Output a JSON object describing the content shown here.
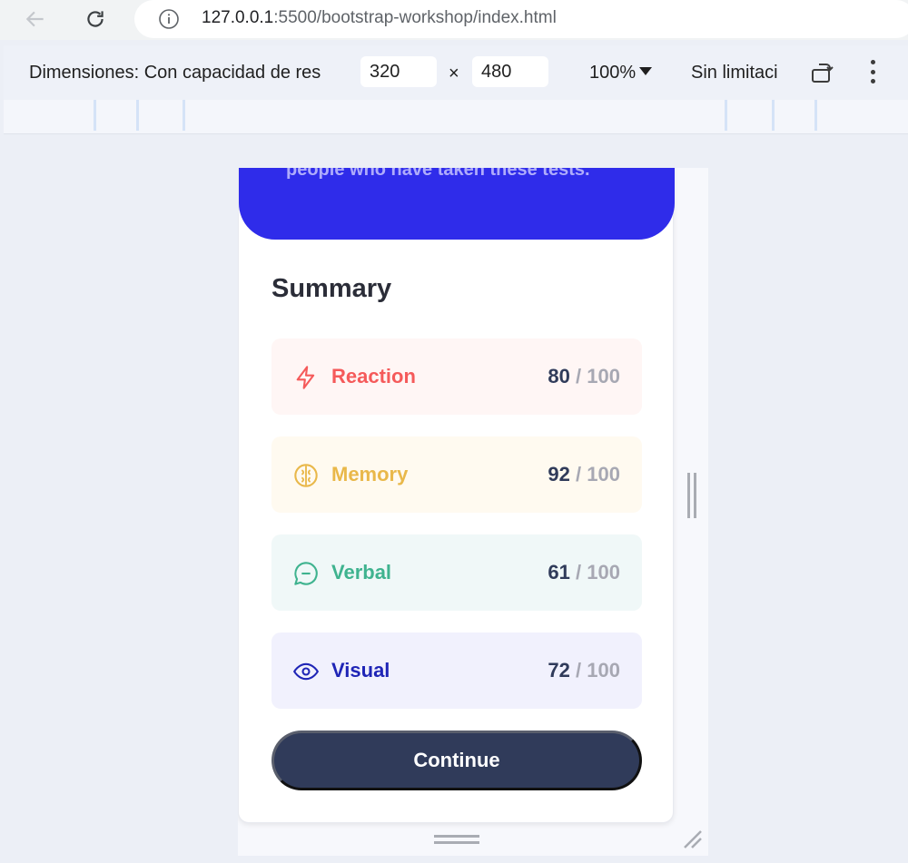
{
  "browser": {
    "url_host": "127.0.0.1",
    "url_rest": ":5500/bootstrap-workshop/index.html",
    "icons": {
      "back": "arrow-left-icon",
      "reload": "reload-icon",
      "info": "info-icon"
    }
  },
  "device_toolbar": {
    "dimensions_label": "Dimensiones: Con capacidad de res",
    "width": "320",
    "x_sep": "×",
    "height": "480",
    "zoom": "100%",
    "throttle": "Sin limitaci"
  },
  "page": {
    "hero_text": "people who have taken these tests.",
    "summary_title": "Summary",
    "separator": "/",
    "rows": [
      {
        "label": "Reaction",
        "score": "80",
        "max": "100",
        "icon": "lightning-icon",
        "color": "#f55a5a"
      },
      {
        "label": "Memory",
        "score": "92",
        "max": "100",
        "icon": "brain-icon",
        "color": "#e9b84a"
      },
      {
        "label": "Verbal",
        "score": "61",
        "max": "100",
        "icon": "chat-bubble-icon",
        "color": "#3fb38f"
      },
      {
        "label": "Visual",
        "score": "72",
        "max": "100",
        "icon": "eye-icon",
        "color": "#1f25b6"
      }
    ],
    "continue_label": "Continue"
  },
  "colors": {
    "hero": "#2f2cea",
    "button": "#303b5a"
  }
}
